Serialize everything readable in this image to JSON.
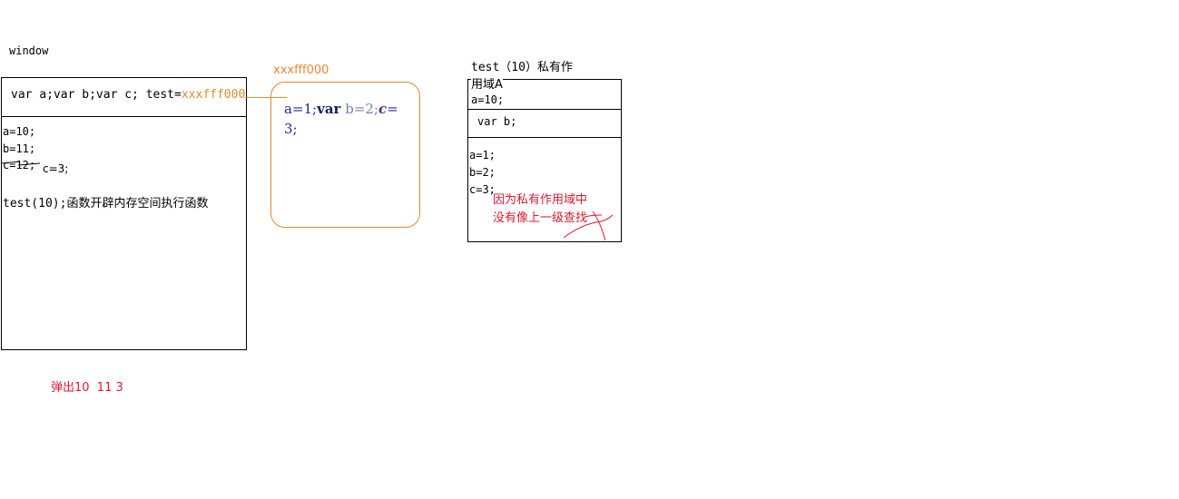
{
  "window_panel": {
    "label": "window",
    "decl_prefix": "var a;var b;var c; test=",
    "decl_addr": "xxxfff000",
    "assign_a": "a=10;",
    "assign_b": "b=11;",
    "assign_c_struck": "c=12;",
    "assign_c_new": "c=3;",
    "call_line": "test(10);函数开辟内存空间执行函数"
  },
  "function_heap": {
    "address": "xxxfff000",
    "code": {
      "part1": "a=1;",
      "var_kw": "var",
      "part2": " b=2;",
      "c_var": "c",
      "part3": "=",
      "part4": "3;"
    }
  },
  "private_scope": {
    "title_line1": "test（10）私有作",
    "title_line2": "用域A",
    "param": "a=10;",
    "decl": "var b;",
    "assign_a": "a=1;",
    "assign_b": "b=2;",
    "assign_c": "c=3;",
    "note_line1": "因为私有作用域中",
    "note_line2": "没有像上一级查找"
  },
  "output_note": "弹出10  11 3",
  "colors": {
    "accent_orange": "#e8872f",
    "note_red": "#e0192d"
  }
}
